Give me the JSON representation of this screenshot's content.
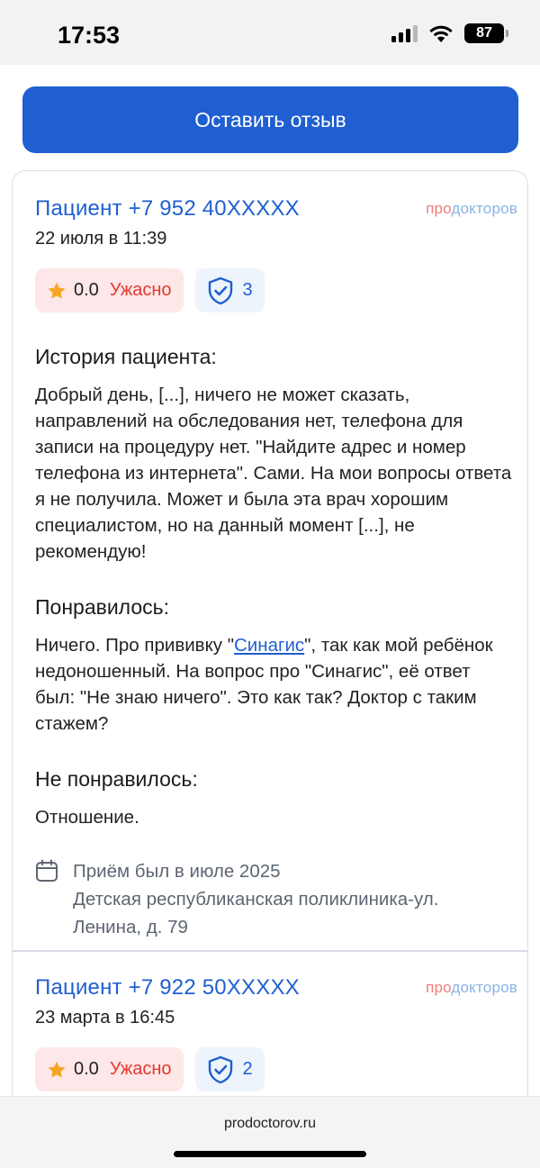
{
  "status": {
    "time": "17:53",
    "battery": "87"
  },
  "leave_review_label": "Оставить отзыв",
  "brand": {
    "part1": "про",
    "part2": "докторов"
  },
  "reviews": [
    {
      "author": "Пациент +7 952 40XXXXX",
      "date": "22 июля в 11:39",
      "rating": "0.0",
      "rating_label": "Ужасно",
      "verified_count": "3",
      "history_title": "История пациента:",
      "history_text": "Добрый день, [...], ничего не может сказать, направлений на обследования нет, телефона для записи на процедуру нет. \"Найдите адрес и номер телефона из интернета\". Сами. На мои вопросы ответа я не получила. Может и была эта врач хорошим специалистом, но на данный момент [...], не рекомендую!",
      "liked_title": "Понравилось:",
      "liked_text_before": "Ничего. Про прививку \"",
      "liked_link": "Синагис",
      "liked_text_after": "\", так как мой ребёнок недоношенный. На вопрос про \"Синагис\", её ответ был: \"Не знаю ничего\". Это как так? Доктор с таким стажем?",
      "disliked_title": "Не понравилось:",
      "disliked_text": "Отношение.",
      "visit_date": "Приём был в июле 2025",
      "visit_place": "Детская республиканская поликлиника-ул. Ленина, д. 79"
    },
    {
      "author": "Пациент +7 922 50XXXXX",
      "date": "23 марта в 16:45",
      "rating": "0.0",
      "rating_label": "Ужасно",
      "verified_count": "2"
    }
  ],
  "browser": {
    "url": "prodoctorov.ru"
  },
  "colors": {
    "accent": "#1f5fd1",
    "bad_rating": "#e23a2e",
    "star": "#f5a623"
  },
  "icons": [
    "signal-icon",
    "wifi-icon",
    "battery-icon",
    "star-icon",
    "shield-check-icon",
    "calendar-icon"
  ]
}
